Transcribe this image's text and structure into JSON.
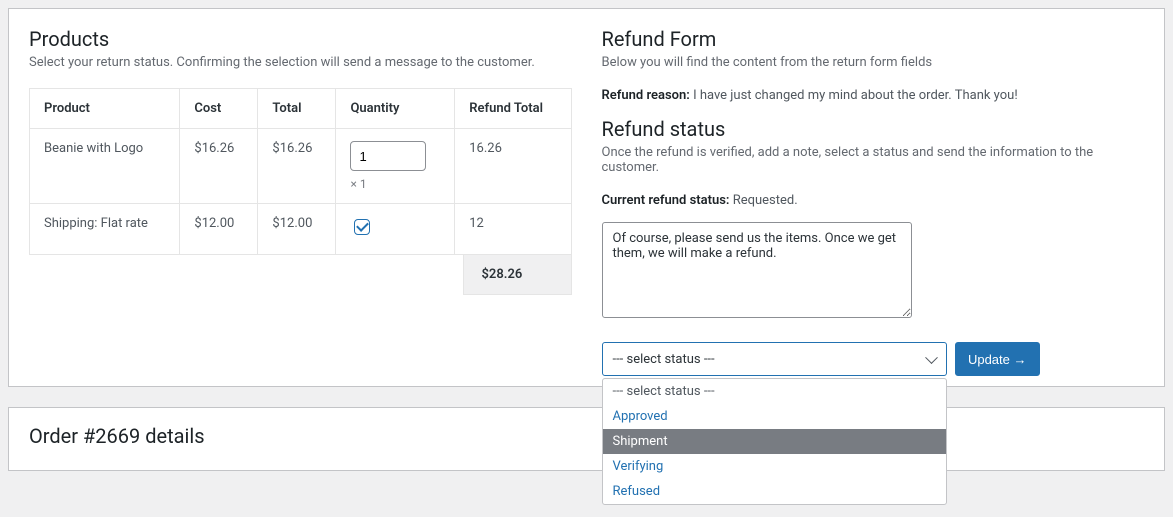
{
  "products": {
    "heading": "Products",
    "subtitle": "Select your return status. Confirming the selection will send a message to the customer.",
    "columns": {
      "product": "Product",
      "cost": "Cost",
      "total": "Total",
      "quantity": "Quantity",
      "refund_total": "Refund Total"
    },
    "rows": [
      {
        "product": "Beanie with Logo",
        "cost": "$16.26",
        "total": "$16.26",
        "qty_value": "1",
        "qty_mult": "× 1",
        "refund_total": "16.26"
      },
      {
        "product": "Shipping: Flat rate",
        "cost": "$12.00",
        "total": "$12.00",
        "checked": true,
        "refund_total": "12"
      }
    ],
    "grand_total": "$28.26"
  },
  "refund_form": {
    "heading": "Refund Form",
    "subtitle": "Below you will find the content from the return form fields",
    "reason_label": "Refund reason:",
    "reason_value": "I have just changed my mind about the order. Thank you!",
    "status_heading": "Refund status",
    "status_subtitle": "Once the refund is verified, add a note, select a status and send the information to the customer.",
    "current_status_label": "Current refund status:",
    "current_status_value": "Requested.",
    "note_value": "Of course, please send us the items. Once we get them, we will make a refund.",
    "select_placeholder": "--- select status ---",
    "options": [
      "--- select status ---",
      "Approved",
      "Shipment",
      "Verifying",
      "Refused"
    ],
    "highlighted_option_index": 2,
    "update_button": "Update →"
  },
  "order_details": {
    "heading": "Order #2669 details"
  }
}
